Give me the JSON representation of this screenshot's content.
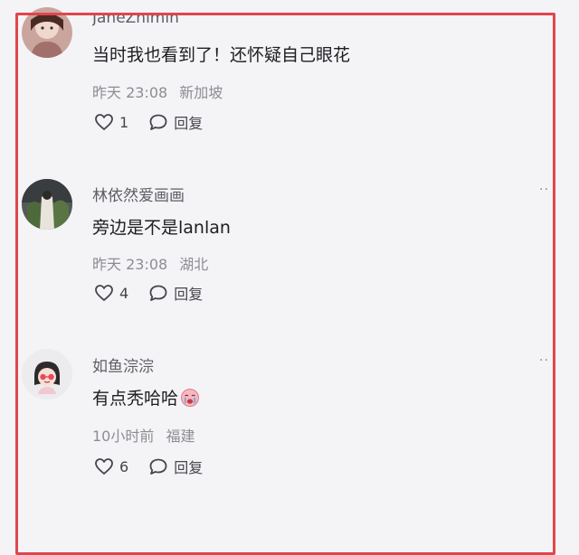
{
  "comments": [
    {
      "username": "JaneZhimin",
      "text": "当时我也看到了！还怀疑自己眼花",
      "time": "昨天 23:08",
      "location": "新加坡",
      "likes": "1",
      "reply_label": "回复",
      "more_label": "··"
    },
    {
      "username": "林依然爱画画",
      "text": "旁边是不是lanlan",
      "time": "昨天 23:08",
      "location": "湖北",
      "likes": "4",
      "reply_label": "回复",
      "more_label": "··"
    },
    {
      "username": "如鱼淙淙",
      "text": "有点秃哈哈",
      "time": "10小时前",
      "location": "福建",
      "likes": "6",
      "reply_label": "回复",
      "more_label": "··"
    }
  ],
  "colors": {
    "frame": "#e0464d",
    "username": "#5d5d66",
    "meta": "#8c8c94"
  },
  "icons": {
    "like": "heart-outline-icon",
    "reply": "speech-bubble-icon",
    "emoji": "crying-face-emoji"
  }
}
